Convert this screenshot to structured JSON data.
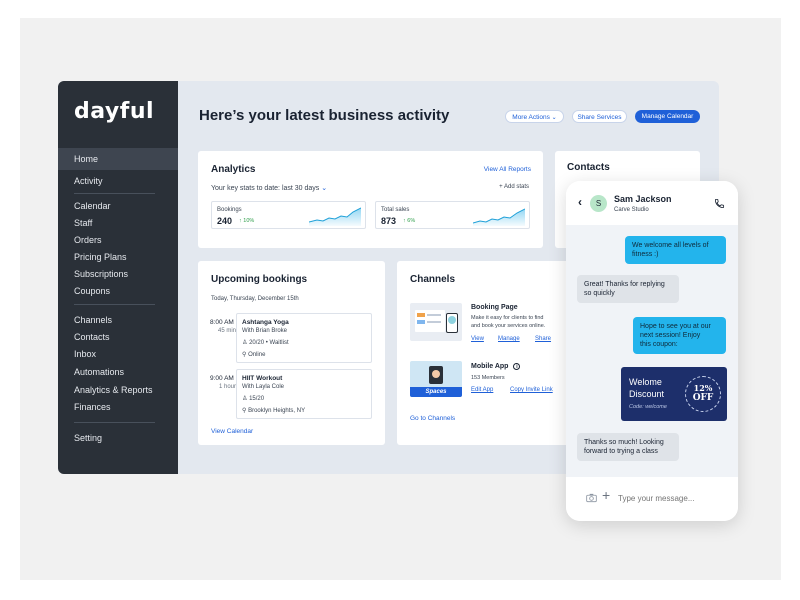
{
  "app": {
    "logo": "dayful"
  },
  "sidebar": {
    "group1": [
      "Home",
      "Activity"
    ],
    "group2": [
      "Calendar",
      "Staff",
      "Orders",
      "Pricing Plans",
      "Subscriptions",
      "Coupons"
    ],
    "group3": [
      "Channels",
      "Contacts",
      "Inbox",
      "Automations",
      "Analytics & Reports",
      "Finances"
    ],
    "group4": [
      "Setting"
    ]
  },
  "header": {
    "title": "Here’s your latest business activity",
    "more_actions": "More Actions",
    "share_services": "Share Services",
    "manage_calendar": "Manage Calendar"
  },
  "analytics": {
    "title": "Analytics",
    "view_all": "View All Reports",
    "subtitle": "Your key stats to date: last 30 days",
    "add_stats": "+ Add stats",
    "stats": [
      {
        "label": "Bookings",
        "value": "240",
        "delta": "10%"
      },
      {
        "label": "Total sales",
        "value": "873",
        "delta": "6%"
      }
    ]
  },
  "contacts": {
    "title": "Contacts"
  },
  "upcoming": {
    "title": "Upcoming bookings",
    "date": "Today, Thursday, December 15th",
    "items": [
      {
        "time": "8:00 AM",
        "duration": "45 min",
        "name": "Ashtanga Yoga",
        "with": "With Brian Broke",
        "capacity": "20/20 • Waitlist",
        "location": "Online"
      },
      {
        "time": "9:00 AM",
        "duration": "1 hour",
        "name": "HIIT Workout",
        "with": "With Layla Cole",
        "capacity": "15/20",
        "location": "Brooklyn Heights, NY"
      }
    ],
    "view_calendar": "View Calendar"
  },
  "channels": {
    "title": "Channels",
    "booking_page": {
      "title": "Booking Page",
      "desc_1": "Make it easy for clients to find",
      "desc_2": "and book your services online.",
      "links": [
        "View",
        "Manage",
        "Share"
      ]
    },
    "mobile_app": {
      "title": "Mobile App",
      "members": "153 Members",
      "tile_label": "Spaces",
      "links": [
        "Edit App",
        "Copy Invite Link"
      ]
    },
    "go_to": "Go to Channels"
  },
  "chat": {
    "avatar_letter": "S",
    "name": "Sam Jackson",
    "studio": "Carve Studio",
    "messages": [
      {
        "from": "out",
        "line1": "We welcome all levels of",
        "line2": "fitness :)"
      },
      {
        "from": "in",
        "line1": "Great! Thanks for replying",
        "line2": "so quickly"
      },
      {
        "from": "out",
        "line1": "Hope to see you at our",
        "line2": "next session! Enjoy",
        "line3": "this coupon:"
      },
      {
        "from": "in",
        "line1": "Thanks so much! Looking",
        "line2": "forward to trying a class"
      }
    ],
    "coupon": {
      "line1": "Welome",
      "line2": "Discount",
      "code": "Code: welcome",
      "percent": "12%",
      "off": "OFF"
    },
    "placeholder": "Type your message..."
  },
  "colors": {
    "sidebar": "#2a3038",
    "accent": "#1f60d8",
    "bubble_out": "#23b4ec",
    "coupon": "#1d2f6b"
  }
}
